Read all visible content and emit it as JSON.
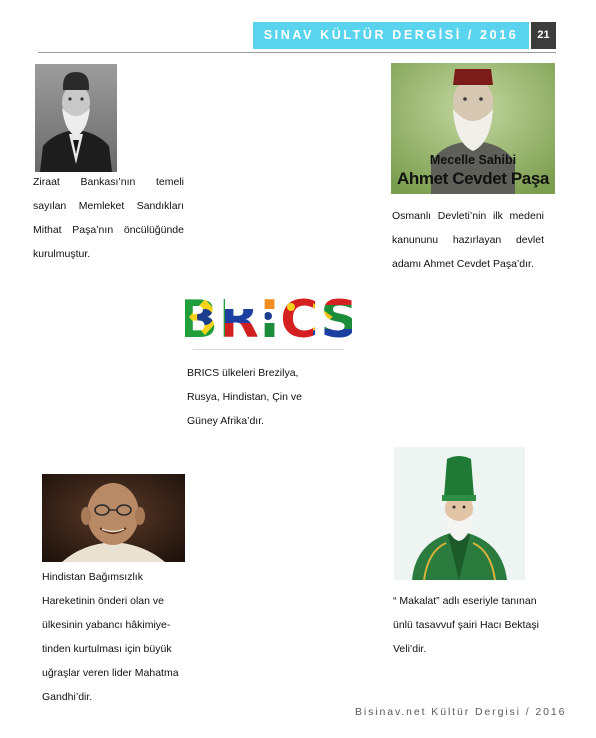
{
  "header": {
    "title": "SINAV KÜLTÜR DERGİSİ / 2016",
    "page_number": "21"
  },
  "articles": {
    "mithat": {
      "lines": [
        "Ziraat Bankası’nın temeli",
        "sayılan Memleket Sandıkları",
        "Mithat Paşa’nın öncülüğünde",
        "kurulmuştur."
      ]
    },
    "cevdet": {
      "image_text_1": "Mecelle Sahibi",
      "image_text_2": "Ahmet Cevdet Paşa",
      "lines": [
        "Osmanlı Devleti’nin ilk medeni",
        "kanununu hazırlayan devlet",
        "adamı Ahmet Cevdet Paşa’dır."
      ]
    },
    "brics": {
      "logo_text": "BRICS",
      "lines": [
        "BRICS ülkeleri Brezilya,",
        "Rusya, Hindistan, Çin ve",
        "Güney Afrika’dır."
      ]
    },
    "gandhi": {
      "lines": [
        "Hindistan Bağımsızlık",
        "Hareketinin önderi olan ve",
        "ülkesinin yabancı hâkimiye-",
        "tinden kurtulması için büyük",
        "uğraşlar veren lider Mahatma",
        "Gandhi’dir."
      ]
    },
    "bektasi": {
      "lines": [
        "“ Makalat” adlı eseriyle tanınan",
        "ünlü tasavvuf şairi Hacı Bektaşi",
        "Veli’dir."
      ]
    }
  },
  "footer": {
    "text": "Bisinav.net Kültür Dergisi / 2016"
  },
  "colors": {
    "header_bg": "#5ad3ee",
    "page_number_bg": "#3c3c3c",
    "cevdet_bg": "#8fb060"
  }
}
